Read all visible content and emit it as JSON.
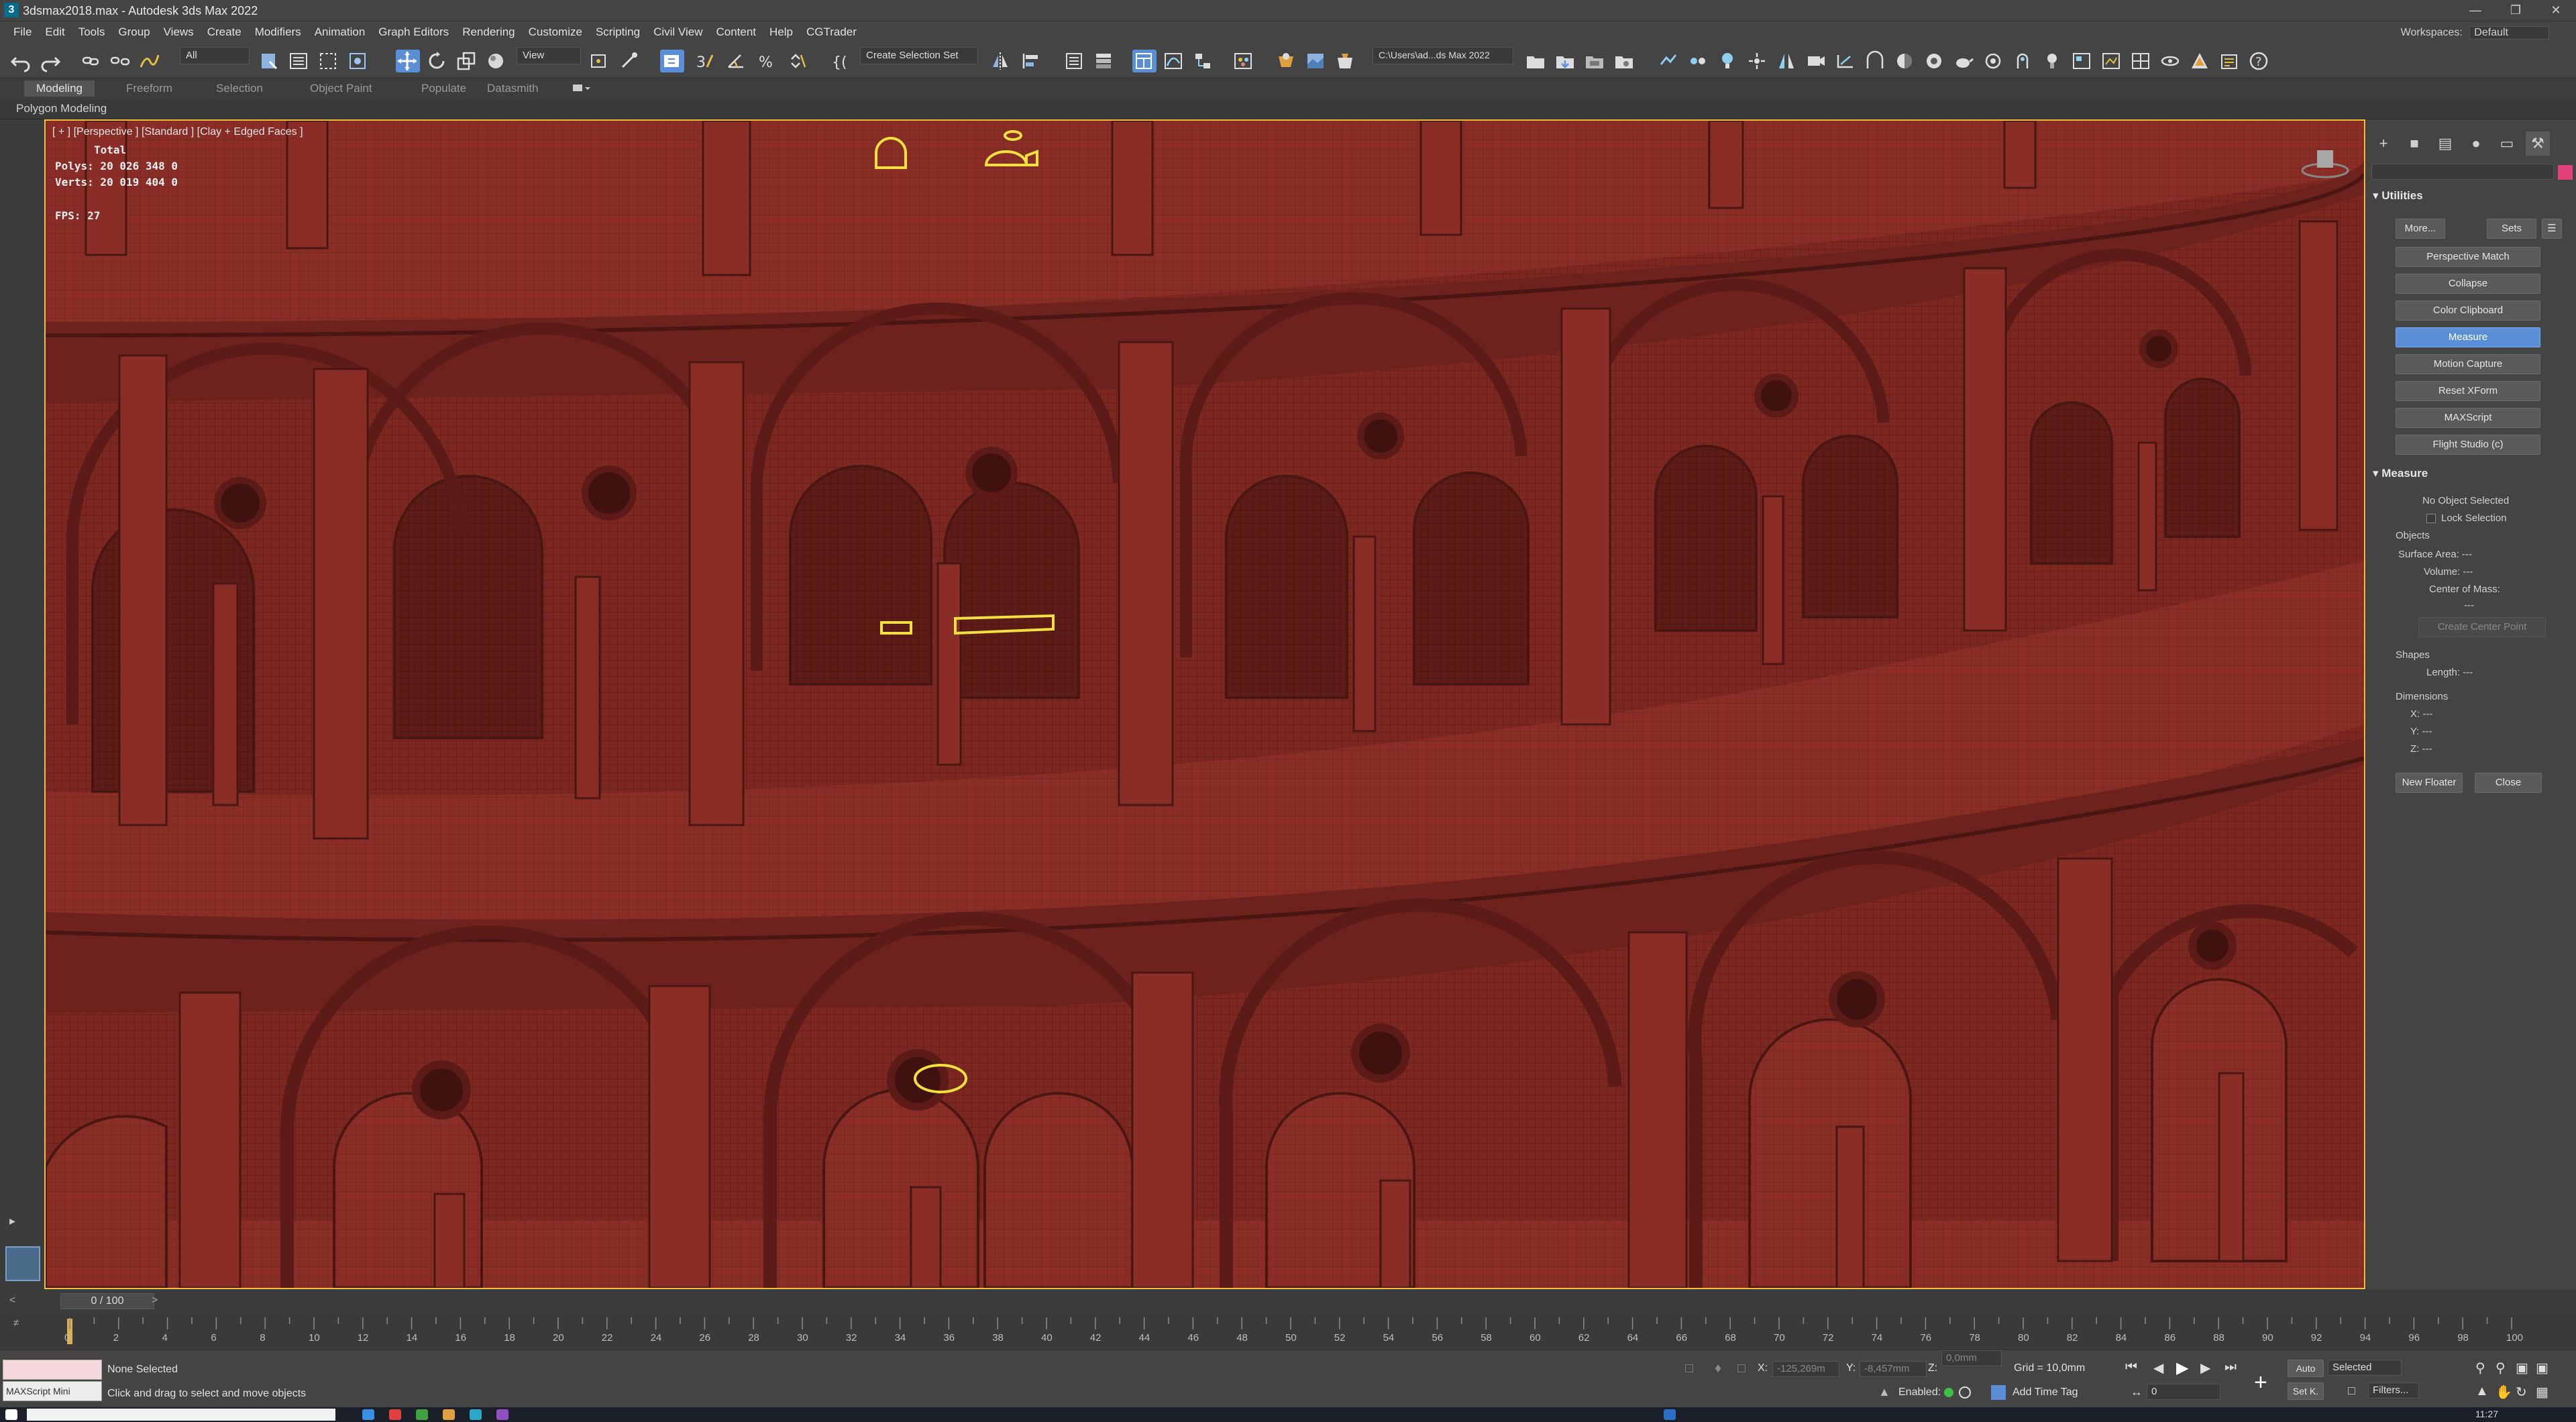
{
  "window": {
    "title": "3dsmax2018.max - Autodesk 3ds Max 2022",
    "app_icon": "3"
  },
  "menu": {
    "items": [
      "File",
      "Edit",
      "Tools",
      "Group",
      "Views",
      "Create",
      "Modifiers",
      "Animation",
      "Graph Editors",
      "Rendering",
      "Customize",
      "Scripting",
      "Civil View",
      "Content",
      "Help",
      "CGTrader"
    ],
    "workspaces_label": "Workspaces:",
    "workspaces_value": "Default"
  },
  "toolbar": {
    "selection_filter": "All",
    "ref_coord": "View",
    "named_selection": "Create Selection Set",
    "project_path": "C:\\Users\\ad...ds Max 2022"
  },
  "ribbon": {
    "tabs": [
      "Modeling",
      "Freeform",
      "Selection",
      "Object Paint",
      "Populate",
      "Datasmith"
    ],
    "active_tab": "Modeling",
    "sub_label": "Polygon Modeling"
  },
  "viewport": {
    "label": "[ + ] [Perspective ] [Standard ] [Clay + Edged Faces ]",
    "stats_total": "Total",
    "stats_polys": "Polys: 20 026 348 0",
    "stats_verts": "Verts: 20 019 404 0",
    "fps": "FPS:    27",
    "mesh_color": "#7a2620",
    "highlight_color": "#f0e040"
  },
  "command_panel": {
    "utilities_title": "Utilities",
    "more_btn": "More...",
    "sets_btn": "Sets",
    "utility_buttons": [
      "Perspective Match",
      "Collapse",
      "Color Clipboard",
      "Measure",
      "Motion Capture",
      "Reset XForm",
      "MAXScript",
      "Flight Studio (c)"
    ],
    "active_utility": "Measure",
    "measure_title": "Measure",
    "no_object": "No Object Selected",
    "lock_selection": "Lock Selection",
    "objects_label": "Objects",
    "surface_area": "Surface Area:  ---",
    "volume": "Volume:  ---",
    "center_of_mass": "Center of Mass:",
    "com_value": "---",
    "create_center_point": "Create Center Point",
    "shapes_label": "Shapes",
    "length": "Length:  ---",
    "dimensions_label": "Dimensions",
    "dim_x": "X:  ---",
    "dim_y": "Y:  ---",
    "dim_z": "Z:  ---",
    "new_floater": "New Floater",
    "close": "Close",
    "accent_color": "#5a8ed6"
  },
  "timeline": {
    "frame_display": "0 / 100",
    "ticks": [
      "0",
      "2",
      "4",
      "6",
      "8",
      "10",
      "12",
      "14",
      "16",
      "18",
      "20",
      "22",
      "24",
      "26",
      "28",
      "30",
      "32",
      "34",
      "36",
      "38",
      "40",
      "42",
      "44",
      "46",
      "48",
      "50",
      "52",
      "54",
      "56",
      "58",
      "60",
      "62",
      "64",
      "66",
      "68",
      "70",
      "72",
      "74",
      "76",
      "78",
      "80",
      "82",
      "84",
      "86",
      "88",
      "90",
      "92",
      "94",
      "96",
      "98",
      "100"
    ]
  },
  "status": {
    "maxscript_label": "MAXScript Mini",
    "selection": "None Selected",
    "prompt": "Click and drag to select and move objects",
    "x_label": "X:",
    "x_value": "-125,269m",
    "y_label": "Y:",
    "y_value": "-8,457mm",
    "z_label": "Z:",
    "z_value": "0,0mm",
    "grid": "Grid = 10,0mm",
    "enabled": "Enabled:",
    "add_time_tag": "Add Time Tag",
    "auto": "Auto",
    "set_key": "Set K.",
    "selected": "Selected",
    "filters": "Filters...",
    "frame_field": "0",
    "clock": "11:27"
  }
}
